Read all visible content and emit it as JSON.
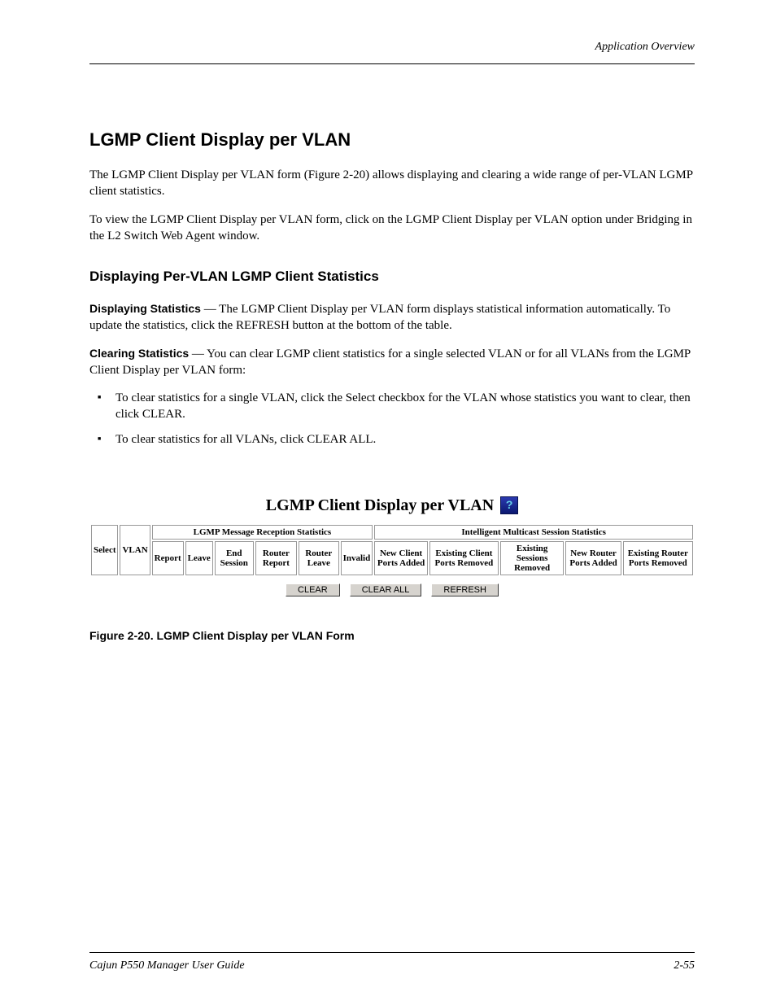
{
  "header": {
    "right": "Application Overview"
  },
  "headings": {
    "section": "LGMP Client Display per VLAN",
    "subsection": "Displaying Per-VLAN LGMP Client Statistics"
  },
  "paragraphs": {
    "intro": "The LGMP Client Display per VLAN form (Figure 2-20) allows displaying and clearing a wide range of per-VLAN LGMP client statistics.",
    "to_view": "To view the LGMP Client Display per VLAN form, click on the LGMP Client Display per VLAN option under Bridging in the L2 Switch Web Agent window.",
    "displaying_label": "Displaying Statistics",
    "displaying_text": " — The LGMP Client Display per VLAN form displays statistical information automatically. To update the statistics, click the REFRESH button at the bottom of the table.",
    "clearing_label": "Clearing Statistics",
    "clearing_text": " — You can clear LGMP client statistics for a single selected VLAN or for all VLANs from the LGMP Client Display per VLAN form:"
  },
  "bullets": [
    "To clear statistics for a single VLAN, click the Select checkbox for the VLAN whose statistics you want to clear, then click CLEAR.",
    "To clear statistics for all VLANs, click CLEAR ALL."
  ],
  "form": {
    "title": "LGMP Client Display per VLAN",
    "group1": "LGMP Message Reception Statistics",
    "group2": "Intelligent Multicast Session Statistics",
    "cols": {
      "select": "Select",
      "vlan": "VLAN",
      "report": "Report",
      "leave": "Leave",
      "end_session": "End Session",
      "router_report": "Router Report",
      "router_leave": "Router Leave",
      "invalid": "Invalid",
      "new_client_ports_added": "New Client Ports Added",
      "existing_client_ports_removed": "Existing Client Ports Removed",
      "existing_sessions_removed": "Existing Sessions Removed",
      "new_router_ports_added": "New Router Ports Added",
      "existing_router_ports_removed": "Existing Router Ports Removed"
    },
    "buttons": {
      "clear": "CLEAR",
      "clear_all": "CLEAR ALL",
      "refresh": "REFRESH"
    }
  },
  "figure_caption": "Figure 2-20.  LGMP Client Display per VLAN Form",
  "footer": {
    "left": "Cajun P550 Manager User Guide",
    "right": "2-55"
  }
}
